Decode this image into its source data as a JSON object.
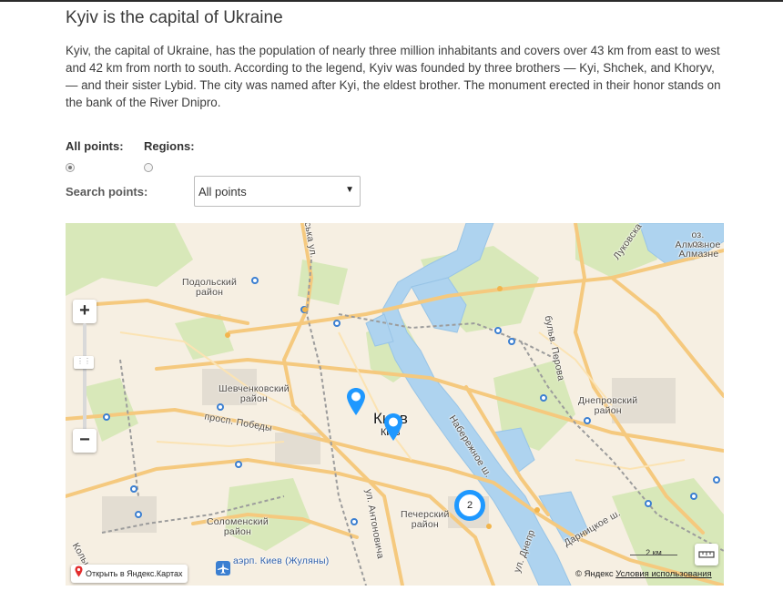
{
  "page": {
    "title": "Kyiv is the capital of Ukraine",
    "intro": "Kyiv, the capital of Ukraine, has the population of nearly three million inhabitants and covers over 43 km from east to west and 42 km from north to south. According to the legend, Kyiv was founded by three brothers — Kyi, Shchek, and Khoryv, — and their sister Lybid. The city was named after Kyi, the eldest brother. The monument erected in their honor stands on the bank of the River Dnipro."
  },
  "filters": {
    "all_points_label": "All points:",
    "regions_label": "Regions:",
    "selected": "all_points",
    "search_label": "Search points:",
    "search_select_value": "All points"
  },
  "map": {
    "city": "Киев",
    "city_small": "Київ",
    "districts": [
      {
        "name": "Подольский район"
      },
      {
        "name": "Шевченковский район"
      },
      {
        "name": "Днепровский район"
      },
      {
        "name": "Печерский район"
      },
      {
        "name": "Соломенский район"
      }
    ],
    "streets": [
      {
        "name": "просп. Победы"
      },
      {
        "name": "Набережное ш."
      },
      {
        "name": "бульв. Перова"
      },
      {
        "name": "Дарницкое ш."
      },
      {
        "name": "ул. Антоновича"
      },
      {
        "name": "ул. Днепр"
      },
      {
        "name": "Луковска"
      },
      {
        "name": "оз. Алмазное"
      },
      {
        "name": "оз. Алмазне"
      },
      {
        "name": "Кольц"
      },
      {
        "name": "рська ул."
      }
    ],
    "airport_label": "аэрп. Киев (Жуляны)",
    "cluster_count": "2",
    "zoom_in": "+",
    "zoom_out": "−",
    "scale_label": "2 км",
    "open_in_yandex": "Открыть в Яндекс.Картах",
    "copyright_prefix": "© Яндекс",
    "terms_link": "Условия использования"
  }
}
